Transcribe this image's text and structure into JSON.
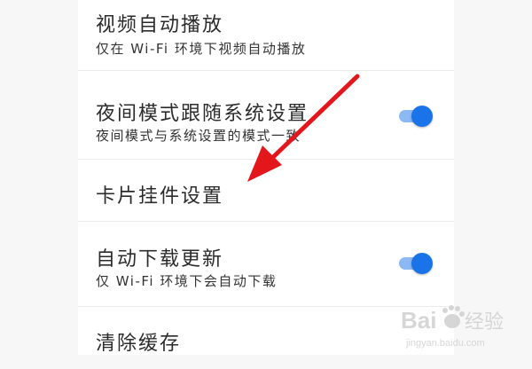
{
  "colors": {
    "accent": "#1a73e8",
    "arrow": "#e3161b",
    "watermark": "#d0d0d0"
  },
  "settings": {
    "items": [
      {
        "title": "视频自动播放",
        "subtitle": "仅在 Wi-Fi 环境下视频自动播放"
      },
      {
        "title": "夜间模式跟随系统设置",
        "subtitle": "夜间模式与系统设置的模式一致",
        "toggle": "on"
      },
      {
        "title": "卡片挂件设置"
      },
      {
        "title": "自动下载更新",
        "subtitle": "仅 Wi-Fi 环境下会自动下载",
        "toggle": "on"
      },
      {
        "title": "清除缓存"
      }
    ]
  },
  "watermark": {
    "brand": "Bai",
    "brand2": "经验",
    "url": "jingyan.baidu.com"
  },
  "icons": {
    "annotation": "red-arrow-icon",
    "watermark": "baidu-paw-icon"
  }
}
